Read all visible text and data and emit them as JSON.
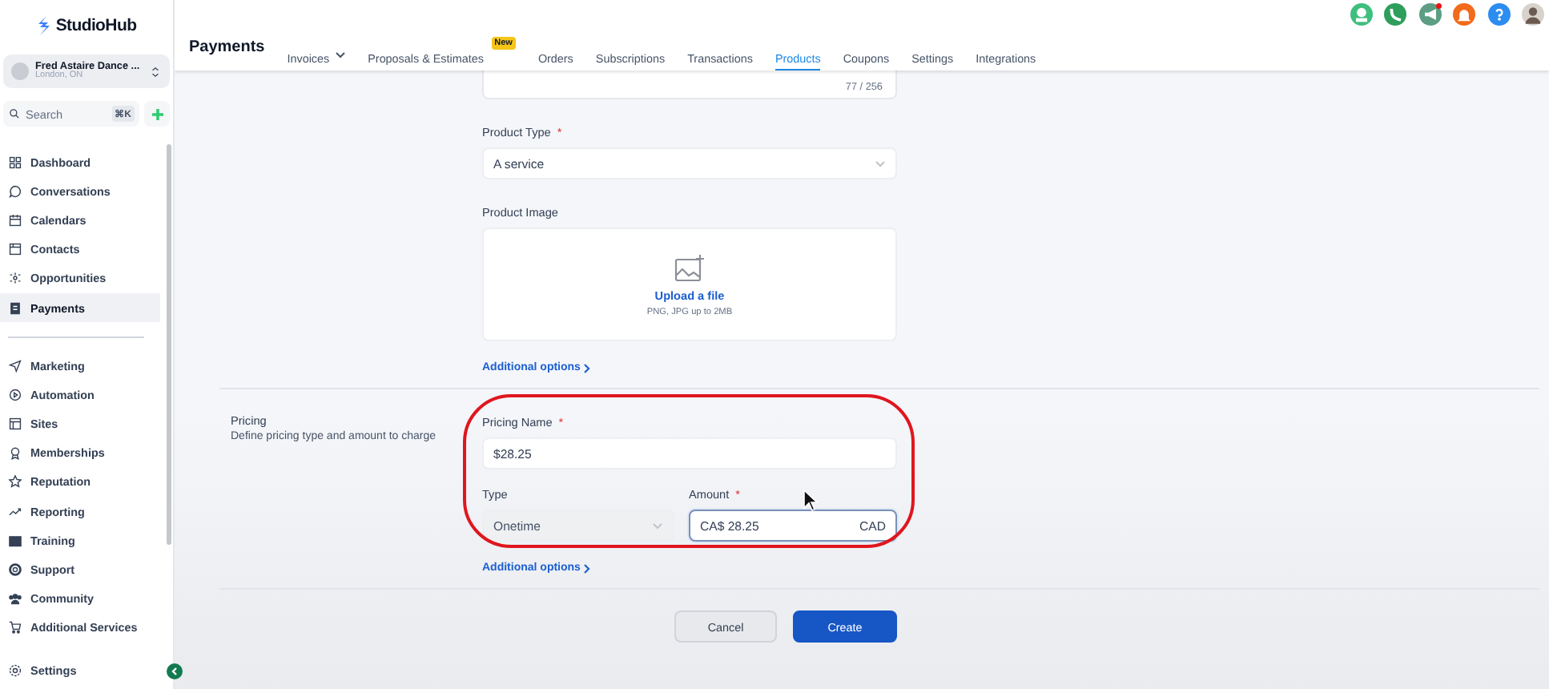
{
  "sidebar": {
    "logo": "StudioHub",
    "account": {
      "name": "Fred Astaire Dance ...",
      "location": "London, ON"
    },
    "search": {
      "placeholder": "Search",
      "shortcut": "⌘K"
    },
    "groups": [
      [
        {
          "label": "Dashboard",
          "selected": false
        },
        {
          "label": "Conversations",
          "selected": false
        },
        {
          "label": "Calendars",
          "selected": false
        },
        {
          "label": "Contacts",
          "selected": false
        },
        {
          "label": "Opportunities",
          "selected": false
        },
        {
          "label": "Payments",
          "selected": true
        }
      ],
      [
        {
          "label": "Marketing",
          "selected": false
        },
        {
          "label": "Automation",
          "selected": false
        },
        {
          "label": "Sites",
          "selected": false
        },
        {
          "label": "Memberships",
          "selected": false
        },
        {
          "label": "Reputation",
          "selected": false
        },
        {
          "label": "Reporting",
          "selected": false
        },
        {
          "label": "Training",
          "selected": false
        },
        {
          "label": "Support",
          "selected": false
        },
        {
          "label": "Community",
          "selected": false
        },
        {
          "label": "Additional Services",
          "selected": false
        }
      ]
    ],
    "footer": "Settings"
  },
  "header": {
    "title": "Payments",
    "tabs": [
      {
        "label": "Invoices",
        "selected": false,
        "dropdown": true
      },
      {
        "label": "Proposals & Estimates",
        "selected": false,
        "badge": "New"
      },
      {
        "label": "Orders",
        "selected": false
      },
      {
        "label": "Subscriptions",
        "selected": false
      },
      {
        "label": "Transactions",
        "selected": false
      },
      {
        "label": "Products",
        "selected": true
      },
      {
        "label": "Coupons",
        "selected": false
      },
      {
        "label": "Settings",
        "selected": false
      },
      {
        "label": "Integrations",
        "selected": false
      }
    ]
  },
  "form": {
    "description_counter": "77 / 256",
    "product_type": {
      "label": "Product Type",
      "required_mark": "*",
      "value": "A service"
    },
    "product_image": {
      "label": "Product Image",
      "upload_link": "Upload a file",
      "hint": "PNG, JPG up to 2MB"
    },
    "additional_options": "Additional options"
  },
  "pricing": {
    "title": "Pricing",
    "description": "Define pricing type and amount to charge",
    "name": {
      "label": "Pricing Name",
      "required_mark": "*",
      "value": "$28.25"
    },
    "type": {
      "label": "Type",
      "value": "Onetime",
      "disabled": true
    },
    "amount": {
      "label": "Amount",
      "required_mark": "*",
      "value": "CA$ 28.25",
      "currency": "CAD",
      "focused": true
    },
    "additional_options": "Additional options"
  },
  "buttons": [
    {
      "label": "Cancel",
      "kind": "secondary"
    },
    {
      "label": "Create",
      "kind": "primary"
    }
  ]
}
